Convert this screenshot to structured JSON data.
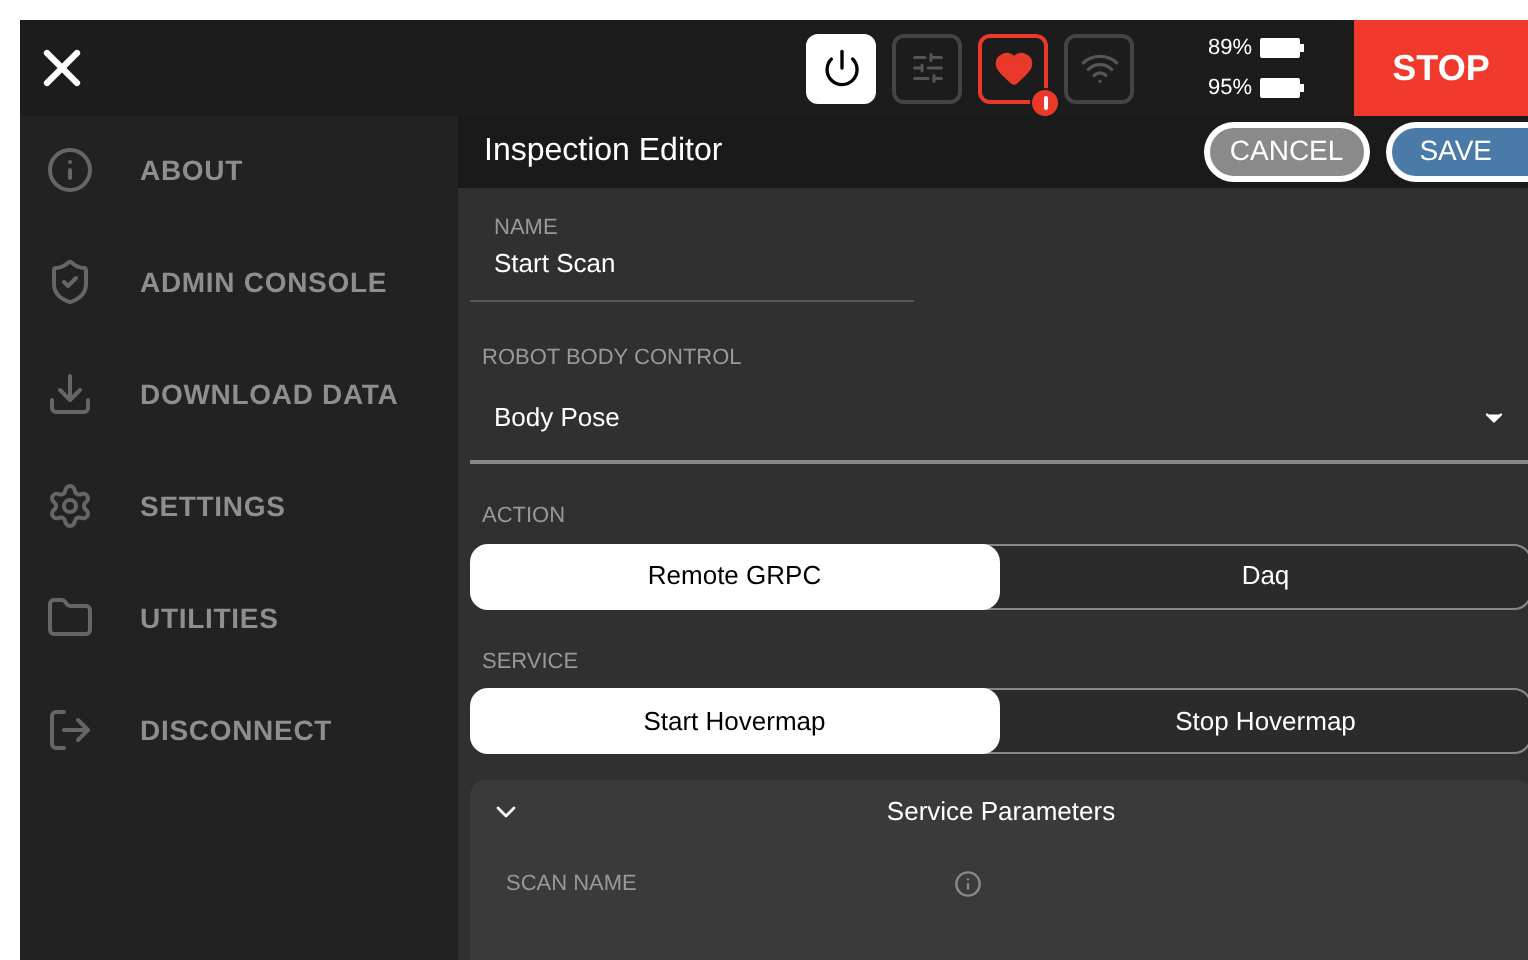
{
  "top_bar": {
    "status_icons": [
      {
        "kind": "power",
        "on": true,
        "alert": false
      },
      {
        "kind": "sliders",
        "on": false,
        "alert": false
      },
      {
        "kind": "heart",
        "on": false,
        "alert": true
      },
      {
        "kind": "wifi",
        "on": false,
        "alert": false
      }
    ],
    "batteries": [
      {
        "reading": "89%"
      },
      {
        "reading": "95%"
      }
    ],
    "stop_button": "STOP"
  },
  "sidebar": {
    "items": [
      {
        "kind": "info",
        "label": "ABOUT"
      },
      {
        "kind": "shield",
        "label": "ADMIN CONSOLE"
      },
      {
        "kind": "download",
        "label": "DOWNLOAD DATA"
      },
      {
        "kind": "gear",
        "label": "SETTINGS"
      },
      {
        "kind": "folder",
        "label": "UTILITIES"
      },
      {
        "kind": "exit",
        "label": "DISCONNECT"
      }
    ]
  },
  "editor": {
    "title": "Inspection Editor",
    "cancel_button": "CANCEL",
    "save_button": "SAVE",
    "name_field": {
      "label": "NAME",
      "value": "Start Scan"
    },
    "body_control": {
      "label": "ROBOT BODY CONTROL",
      "value": "Body Pose"
    },
    "action": {
      "label": "ACTION",
      "options": [
        {
          "label": "Remote GRPC",
          "selected": true
        },
        {
          "label": "Daq",
          "selected": false
        }
      ]
    },
    "service": {
      "label": "SERVICE",
      "options": [
        {
          "label": "Start Hovermap",
          "selected": true
        },
        {
          "label": "Stop Hovermap",
          "selected": false
        }
      ]
    },
    "service_parameters": {
      "title": "Service Parameters",
      "expanded": true,
      "scan_name": {
        "label": "SCAN NAME"
      }
    }
  }
}
